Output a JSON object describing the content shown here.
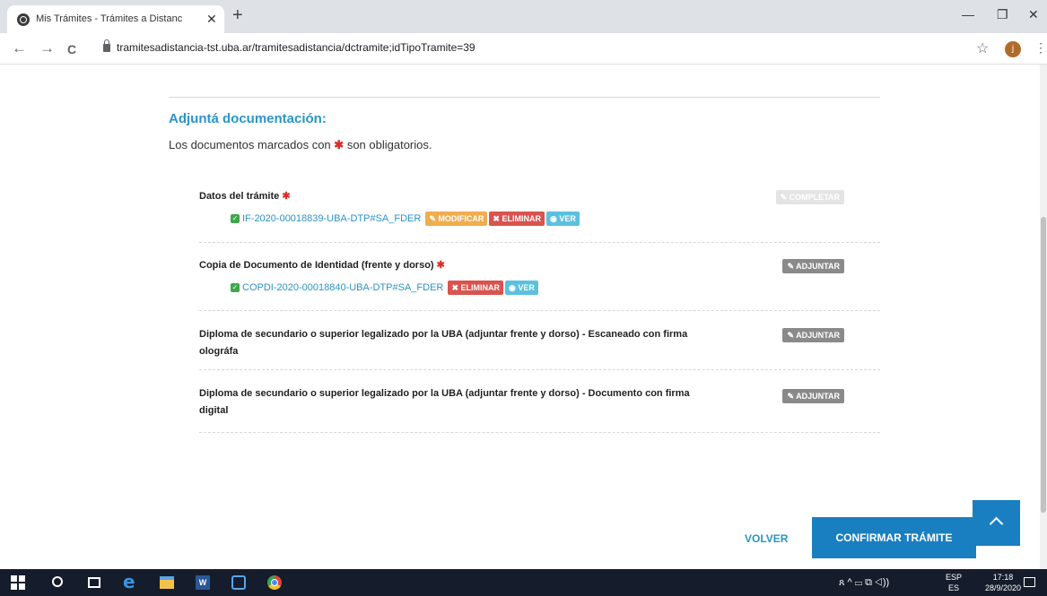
{
  "browser": {
    "tab_title": "Mis Trámites - Trámites a Distanc",
    "tab_close": "✕",
    "new_tab": "+",
    "url": "tramitesadistancia-tst.uba.ar/tramitesadistancia/dctramite;idTipoTramite=39",
    "avatar_letter": "j",
    "window_controls": {
      "minimize": "—",
      "restore": "❐",
      "close": "✕"
    },
    "nav": {
      "back": "←",
      "forward": "→",
      "reload": "C"
    },
    "star": "☆",
    "menu": "⋮"
  },
  "page": {
    "section_title": "Adjuntá documentación:",
    "note_before": "Los documentos marcados con",
    "note_star": "✱",
    "note_after": "son obligatorios.",
    "required_mark": "✱",
    "documents": [
      {
        "title": "Datos del trámite",
        "required": true,
        "action": "COMPLETAR",
        "action_icon": "pencil-icon",
        "action_disabled": true,
        "file": {
          "name": "IF-2020-00018839-UBA-DTP#SA_FDER",
          "labels": {
            "modify": "MODIFICAR",
            "delete": "ELIMINAR",
            "view": "VER"
          }
        }
      },
      {
        "title": "Copia de Documento de Identidad (frente y dorso)",
        "required": true,
        "action": "ADJUNTAR",
        "action_icon": "tag-icon",
        "file": {
          "name": "COPDI-2020-00018840-UBA-DTP#SA_FDER",
          "labels": {
            "delete": "ELIMINAR",
            "view": "VER"
          }
        }
      },
      {
        "title_line1": "Diploma de secundario o superior legalizado por la UBA (adjuntar frente y dorso) - Escaneado con firma",
        "title_line2": "olográfa",
        "required": false,
        "action": "ADJUNTAR",
        "action_icon": "tag-icon"
      },
      {
        "title_line1": "Diploma de secundario o superior legalizado por la UBA (adjuntar frente y dorso) - Documento con firma",
        "title_line2": "digital",
        "required": false,
        "action": "ADJUNTAR",
        "action_icon": "tag-icon"
      }
    ],
    "back_button": "VOLVER",
    "confirm_button": "CONFIRMAR TRÁMITE"
  },
  "taskbar": {
    "word_letter": "W",
    "edge_letter": "e",
    "tray_symbols": "ጸ  ^  ▭  ⧉  ◁))",
    "lang_line1": "ESP",
    "lang_line2": "ES",
    "time": "17:18",
    "date": "28/9/2020"
  },
  "colors": {
    "accent_blue": "#2b94c7",
    "button_blue": "#1a7fc0",
    "required_red": "#d9302c",
    "label_warning": "#f0ad4e",
    "label_danger": "#d9534f",
    "label_info": "#5bc0de",
    "check_green": "#3da84a"
  }
}
